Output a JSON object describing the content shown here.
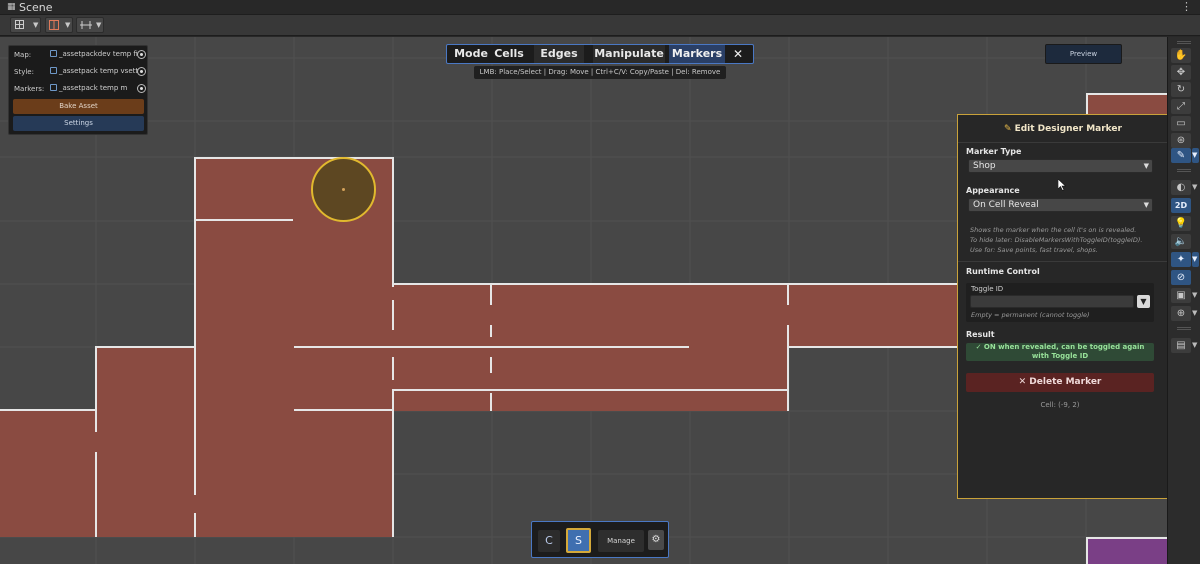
{
  "window": {
    "title": "Scene",
    "grid_icon": "grid-icon",
    "menu_icon": "kebab-icon"
  },
  "map_panel": {
    "rows": [
      {
        "label": "Map:",
        "value": "_assetpackdev temp fi"
      },
      {
        "label": "Style:",
        "value": "_assetpack temp vsett"
      },
      {
        "label": "Markers:",
        "value": "_assetpack temp m"
      }
    ],
    "bake_label": "Bake Asset",
    "settings_label": "Settings"
  },
  "mode_bar": {
    "label": "Mode",
    "tabs": [
      "Cells",
      "Edges",
      "Manipulate",
      "Markers"
    ],
    "active_tab": "Markers",
    "close_symbol": "✕",
    "hint": "LMB: Place/Select | Drag: Move | Ctrl+C/V: Copy/Paste | Del: Remove"
  },
  "preview_label": "Preview",
  "marker_panel": {
    "title": "Edit Designer Marker",
    "marker_type_label": "Marker Type",
    "marker_type_value": "Shop",
    "appearance_label": "Appearance",
    "appearance_value": "On Cell Reveal",
    "appearance_desc": [
      "Shows the marker when the cell it's on is revealed.",
      "To hide later: DisableMarkersWithToggleID(toggleID).",
      "Use for: Save points, fast travel, shops."
    ],
    "runtime_label": "Runtime Control",
    "toggle_label": "Toggle ID",
    "toggle_value": "",
    "toggle_hint": "Empty = permanent (cannot toggle)",
    "result_label": "Result",
    "result_line1": "✓ ON when revealed, can be toggled again",
    "result_line2": "with Toggle ID",
    "delete_label": "✕ Delete Marker",
    "cell_label": "Cell: (-9, 2)"
  },
  "bottom_bar": {
    "c_label": "C",
    "s_label": "S",
    "manage_label": "Manage",
    "gear_icon": "gear-icon"
  },
  "side_tools": {
    "active": [
      "brush-tool",
      "2d-toggle",
      "effects-toggle",
      "visibility-toggle"
    ],
    "two_d_label": "2D"
  },
  "colors": {
    "room": "#8a4b41",
    "wall": "#e6e6e6",
    "accent_blue": "#4a78c4",
    "marker_gold": "#e1b92e",
    "panel_border": "#c9a23a"
  }
}
